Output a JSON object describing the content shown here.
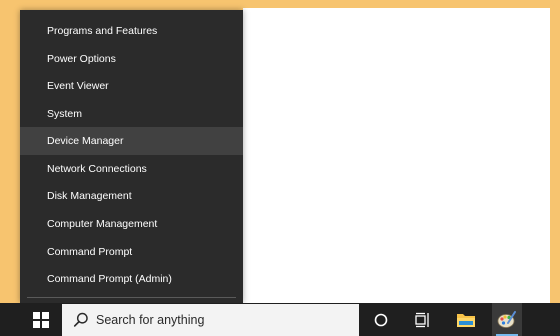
{
  "menu": {
    "items": [
      {
        "label": "Programs and Features"
      },
      {
        "label": "Power Options"
      },
      {
        "label": "Event Viewer"
      },
      {
        "label": "System"
      },
      {
        "label": "Device Manager"
      },
      {
        "label": "Network Connections"
      },
      {
        "label": "Disk Management"
      },
      {
        "label": "Computer Management"
      },
      {
        "label": "Command Prompt"
      },
      {
        "label": "Command Prompt (Admin)"
      }
    ]
  },
  "taskbar": {
    "search_placeholder": "Search for anything",
    "start_icon": "windows-logo-icon",
    "icons": [
      "cortana-icon",
      "task-view-icon",
      "file-explorer-icon",
      "paint-icon"
    ],
    "accent": "#76b9ed"
  },
  "colors": {
    "desktop": "#f7c46f",
    "menu_bg": "#2b2b2b",
    "menu_hover": "#414141",
    "taskbar_bg": "#1f1f1f"
  }
}
